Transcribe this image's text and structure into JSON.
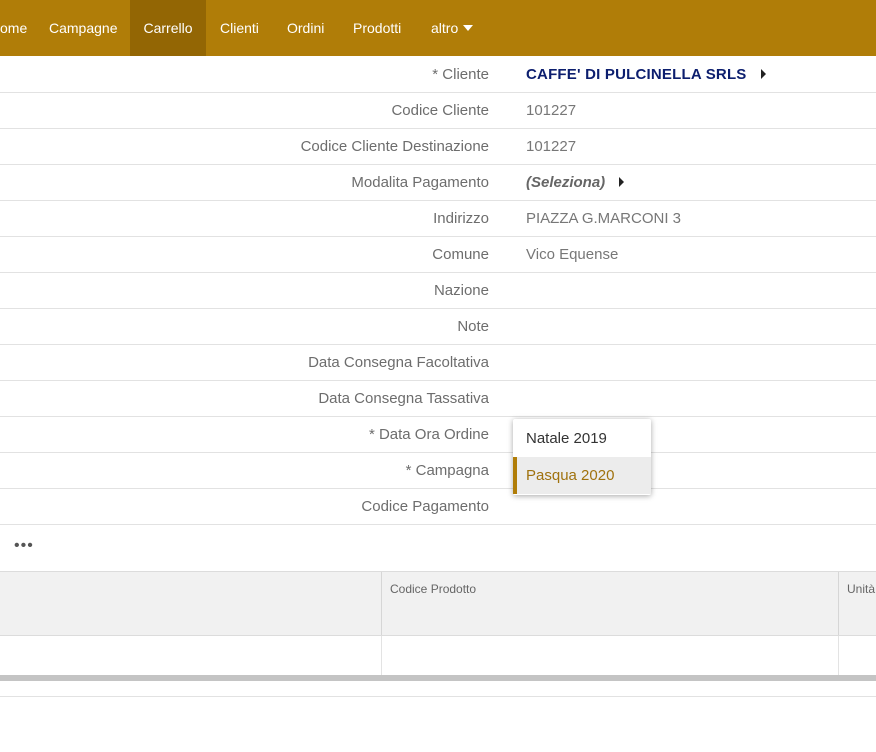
{
  "nav": {
    "items": [
      {
        "label": "ome"
      },
      {
        "label": "Campagne"
      },
      {
        "label": "Carrello"
      },
      {
        "label": "Clienti"
      },
      {
        "label": "Ordini"
      },
      {
        "label": "Prodotti"
      },
      {
        "label": "altro"
      }
    ],
    "active": "Carrello"
  },
  "form": {
    "rows": [
      {
        "label": "* Cliente",
        "value": "CAFFE' DI PULCINELLA SRLS"
      },
      {
        "label": "Codice Cliente",
        "value": "101227"
      },
      {
        "label": "Codice Cliente Destinazione",
        "value": "101227"
      },
      {
        "label": "Modalita Pagamento",
        "value": "(Seleziona)"
      },
      {
        "label": "Indirizzo",
        "value": "PIAZZA G.MARCONI 3"
      },
      {
        "label": "Comune",
        "value": "Vico Equense"
      },
      {
        "label": "Nazione",
        "value": ""
      },
      {
        "label": "Note",
        "value": ""
      },
      {
        "label": "Data Consegna Facoltativa",
        "value": ""
      },
      {
        "label": "Data Consegna Tassativa",
        "value": ""
      },
      {
        "label": "* Data Ora Ordine",
        "value": ""
      },
      {
        "label": "* Campagna",
        "value": ""
      },
      {
        "label": "Codice Pagamento",
        "value": ""
      }
    ]
  },
  "dropdown": {
    "options": [
      {
        "label": "Natale 2019"
      },
      {
        "label": "Pasqua 2020"
      }
    ],
    "selected": "Pasqua 2020"
  },
  "more": {
    "label": "•••"
  },
  "table": {
    "columns": [
      "",
      "Codice Prodotto",
      "Unità"
    ]
  },
  "colors": {
    "nav_bg": "#b07d08",
    "nav_active": "#936604",
    "link": "#0c1e6e",
    "accent": "#b07d08"
  }
}
